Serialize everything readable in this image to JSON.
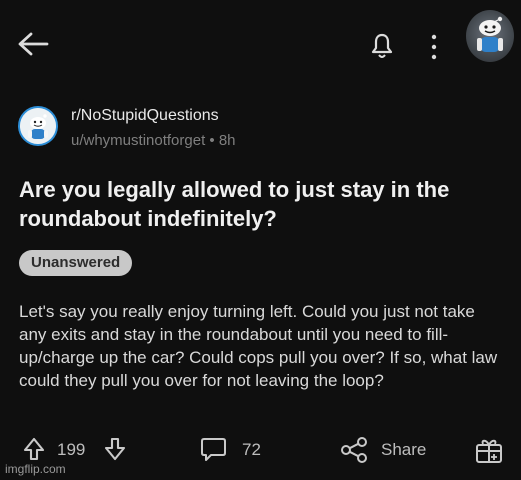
{
  "header": {
    "back_icon": "back-arrow-icon",
    "notification_icon": "bell-icon",
    "more_icon": "vertical-dots-icon",
    "avatar_icon": "reddit-avatar"
  },
  "post": {
    "subreddit": "r/NoStupidQuestions",
    "author": "u/whymustinotforget",
    "separator": "•",
    "age": "8h",
    "title": "Are you legally allowed to just stay in the roundabout indefinitely?",
    "flair": "Unanswered",
    "body": "Let's say you really enjoy turning left. Could you just not take any exits and stay in the roundabout until you need to fill-up/charge up the car? Could cops pull you over? If so, what law could they pull you over for not leaving the loop?"
  },
  "actions": {
    "upvote_icon": "up-arrow-icon",
    "vote_count": "199",
    "downvote_icon": "down-arrow-icon",
    "comment_icon": "comment-bubble-icon",
    "comment_count": "72",
    "share_icon": "share-icon",
    "share_label": "Share",
    "award_icon": "gift-icon"
  },
  "watermark": "imgflip.com",
  "colors": {
    "background": "#0f0f0f",
    "title_text": "#f0f0f0",
    "body_text": "#d9d9d9",
    "muted_text": "#7f7f7f",
    "flair_background": "#c8c8c8",
    "accent_blue": "#2d8ed7"
  }
}
